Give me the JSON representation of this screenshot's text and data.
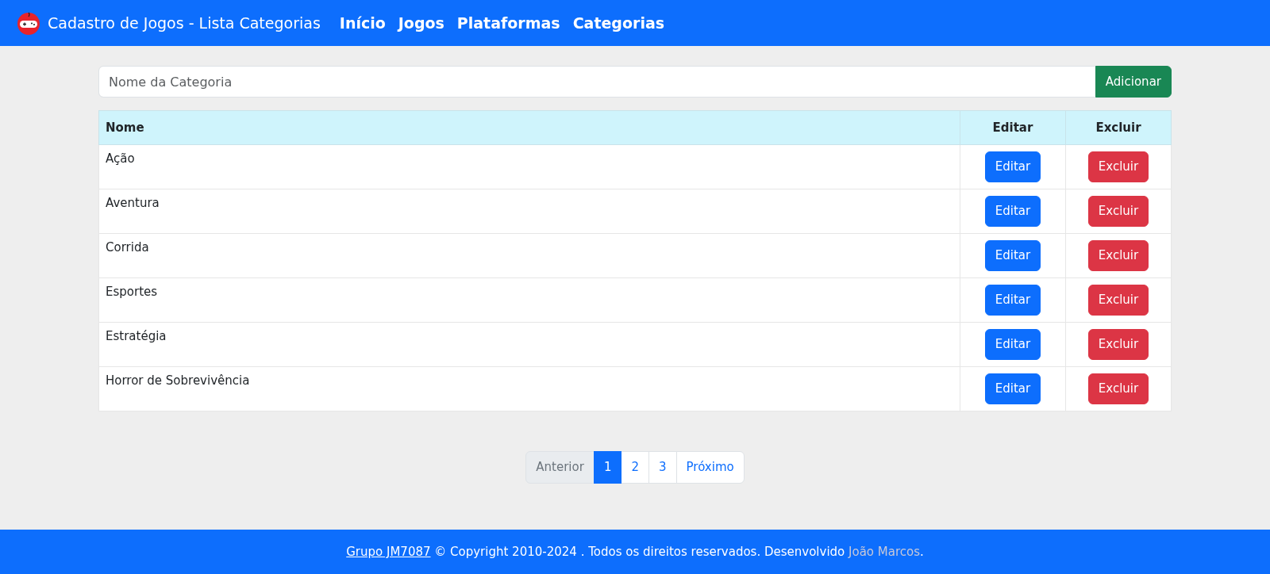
{
  "navbar": {
    "brand": "Cadastro de Jogos - Lista Categorias",
    "links": [
      {
        "label": "Início"
      },
      {
        "label": "Jogos"
      },
      {
        "label": "Plataformas"
      },
      {
        "label": "Categorias"
      }
    ]
  },
  "form": {
    "placeholder": "Nome da Categoria",
    "button": "Adicionar"
  },
  "table": {
    "columns": [
      "Nome",
      "Editar",
      "Excluir"
    ],
    "rows": [
      {
        "name": "Ação",
        "edit": "Editar",
        "delete": "Excluir"
      },
      {
        "name": "Aventura",
        "edit": "Editar",
        "delete": "Excluir"
      },
      {
        "name": "Corrida",
        "edit": "Editar",
        "delete": "Excluir"
      },
      {
        "name": "Esportes",
        "edit": "Editar",
        "delete": "Excluir"
      },
      {
        "name": "Estratégia",
        "edit": "Editar",
        "delete": "Excluir"
      },
      {
        "name": "Horror de Sobrevivência",
        "edit": "Editar",
        "delete": "Excluir"
      }
    ]
  },
  "pagination": [
    {
      "label": "Anterior",
      "selected": false,
      "disabled": true
    },
    {
      "label": "1",
      "selected": true,
      "disabled": false
    },
    {
      "label": "2",
      "selected": false,
      "disabled": false
    },
    {
      "label": "3",
      "selected": false,
      "disabled": false
    },
    {
      "label": "Próximo",
      "selected": false,
      "disabled": false
    }
  ],
  "footer": {
    "brand_link": "Grupo JM7087",
    "text": " © Copyright 2010-2024 . Todos os direitos reservados. Desenvolvido ",
    "author_link": "João Marcos",
    "end": "."
  }
}
